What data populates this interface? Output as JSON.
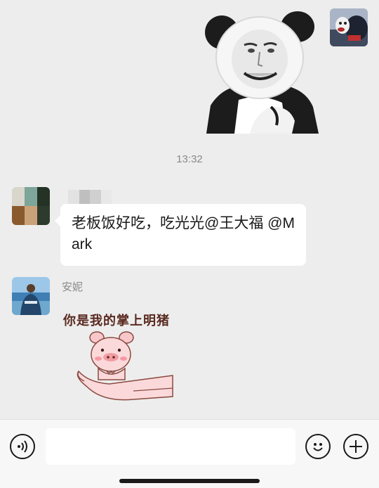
{
  "colors": {
    "background": "#ededed",
    "bubble": "#ffffff",
    "timestamp": "#8a8a8a",
    "text": "#1a1a1a",
    "input_bar": "#f7f7f7"
  },
  "messages": [
    {
      "direction": "outgoing",
      "type": "sticker",
      "sticker_icon": "panda-meme-sticker-icon",
      "avatar_icon": "dog-avatar-icon"
    },
    {
      "type": "timestamp",
      "text": "13:32"
    },
    {
      "direction": "incoming",
      "type": "text",
      "sender": "",
      "avatar_icon": "blurred-avatar-icon",
      "text": "老板饭好吃，吃光光@王大福  @Mark"
    },
    {
      "direction": "incoming",
      "type": "sticker",
      "sender": "安妮",
      "avatar_icon": "beach-person-avatar-icon",
      "sticker_icon": "pig-in-hand-sticker-icon",
      "sticker_caption": "你是我的掌上明猪"
    }
  ],
  "input_bar": {
    "voice_icon": "voice-icon",
    "emoji_icon": "emoji-icon",
    "plus_icon": "plus-icon",
    "placeholder": "",
    "value": ""
  }
}
